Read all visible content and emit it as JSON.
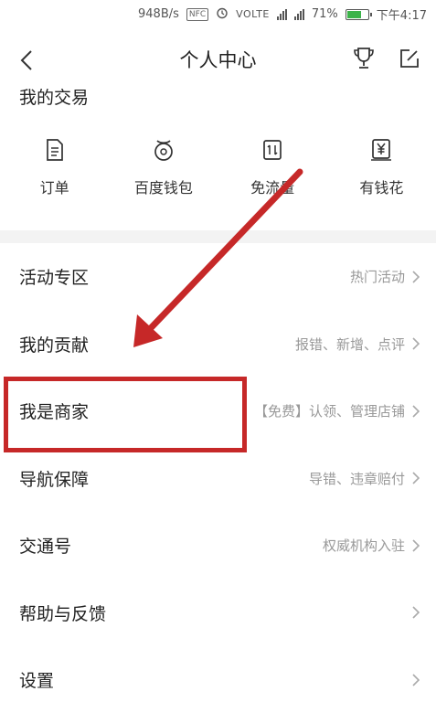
{
  "status_bar": {
    "net_speed": "948B/s",
    "nfc": "NFC",
    "alarm_icon": "alarm-icon",
    "volte": "VOLTE",
    "sim2": "4G",
    "battery_percent": "71%",
    "battery_level": 0.71,
    "time": "下午4:17"
  },
  "header": {
    "title": "个人中心",
    "back_icon": "back-chevron-icon",
    "trophy_icon": "trophy-icon",
    "edit_icon": "edit-icon"
  },
  "transactions": {
    "title": "我的交易",
    "items": [
      {
        "label": "订单",
        "icon": "document-icon"
      },
      {
        "label": "百度钱包",
        "icon": "wallet-icon"
      },
      {
        "label": "免流量",
        "icon": "data-free-icon"
      },
      {
        "label": "有钱花",
        "icon": "yen-icon"
      }
    ]
  },
  "menu": {
    "items": [
      {
        "label": "活动专区",
        "hint": "热门活动"
      },
      {
        "label": "我的贡献",
        "hint": "报错、新增、点评"
      },
      {
        "label": "我是商家",
        "hint": "【免费】认领、管理店铺"
      },
      {
        "label": "导航保障",
        "hint": "导错、违章赔付"
      },
      {
        "label": "交通号",
        "hint": "权威机构入驻"
      },
      {
        "label": "帮助与反馈",
        "hint": ""
      },
      {
        "label": "设置",
        "hint": ""
      }
    ]
  },
  "colors": {
    "annotation": "#c62828",
    "battery": "#3cb34a",
    "hint": "#999999",
    "divider_band": "#f3f3f3"
  }
}
